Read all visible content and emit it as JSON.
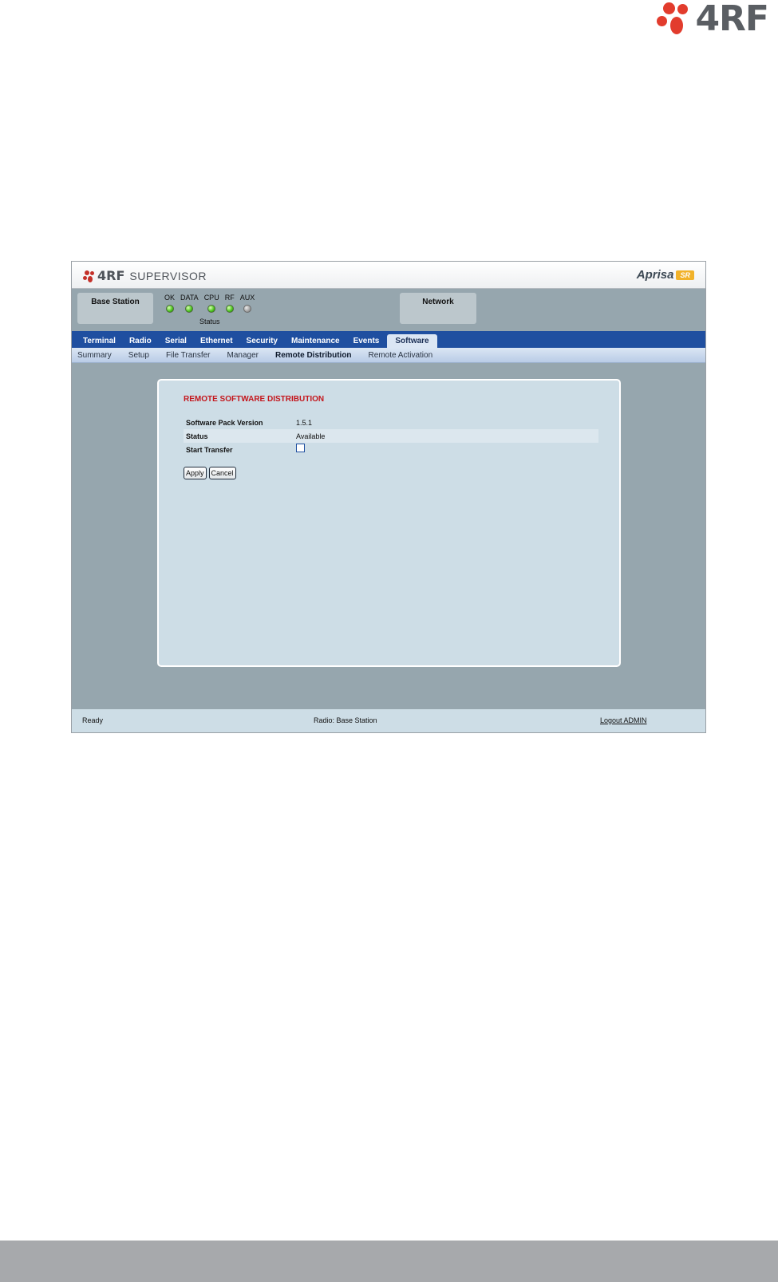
{
  "brand": {
    "name": "4RF",
    "accent_color": "#e23c2d"
  },
  "app": {
    "logo_brand": "4RF",
    "logo_word": "SUPERVISOR",
    "product_name": "Aprisa",
    "product_badge": "SR"
  },
  "status_panel": {
    "base_label": "Base Station",
    "network_label": "Network",
    "status_caption": "Status",
    "leds": [
      {
        "label": "OK",
        "state": "green"
      },
      {
        "label": "DATA",
        "state": "green"
      },
      {
        "label": "CPU",
        "state": "green"
      },
      {
        "label": "RF",
        "state": "green"
      },
      {
        "label": "AUX",
        "state": "grey"
      }
    ]
  },
  "tabs": [
    {
      "label": "Terminal"
    },
    {
      "label": "Radio"
    },
    {
      "label": "Serial"
    },
    {
      "label": "Ethernet"
    },
    {
      "label": "Security"
    },
    {
      "label": "Maintenance"
    },
    {
      "label": "Events"
    },
    {
      "label": "Software",
      "active": true
    }
  ],
  "subtabs": [
    {
      "label": "Summary"
    },
    {
      "label": "Setup"
    },
    {
      "label": "File Transfer"
    },
    {
      "label": "Manager"
    },
    {
      "label": "Remote Distribution",
      "active": true
    },
    {
      "label": "Remote Activation"
    }
  ],
  "content": {
    "section_title": "REMOTE SOFTWARE DISTRIBUTION",
    "fields": {
      "pack_version_label": "Software Pack Version",
      "pack_version_value": "1.5.1",
      "status_label": "Status",
      "status_value": "Available",
      "start_transfer_label": "Start Transfer"
    },
    "apply_label": "Apply",
    "cancel_label": "Cancel"
  },
  "footer": {
    "state": "Ready",
    "radio": "Radio: Base Station",
    "logout": "Logout ADMIN"
  }
}
